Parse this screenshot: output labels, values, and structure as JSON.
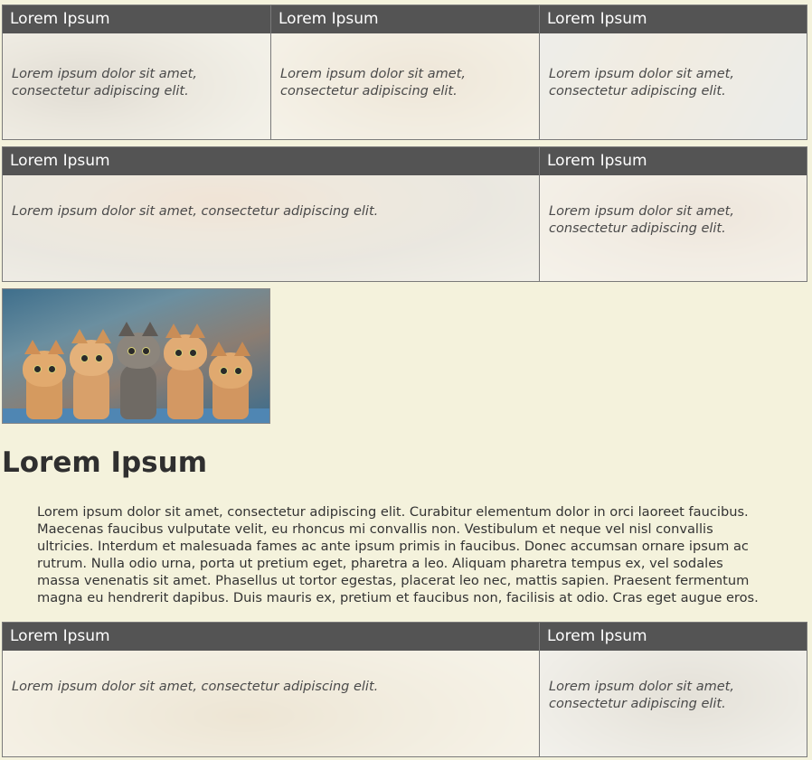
{
  "cards": [
    {
      "title": "Lorem Ipsum",
      "text": "Lorem ipsum dolor sit amet, consectetur adipiscing elit."
    },
    {
      "title": "Lorem Ipsum",
      "text": "Lorem ipsum dolor sit amet, consectetur adipiscing elit."
    },
    {
      "title": "Lorem Ipsum",
      "text": "Lorem ipsum dolor sit amet, consectetur adipiscing elit."
    },
    {
      "title": "Lorem Ipsum",
      "text": "Lorem ipsum dolor sit amet, consectetur adipiscing elit."
    },
    {
      "title": "Lorem Ipsum",
      "text": "Lorem ipsum dolor sit amet, consectetur adipiscing elit."
    }
  ],
  "article": {
    "heading": "Lorem Ipsum",
    "body": "Lorem ipsum dolor sit amet, consectetur adipiscing elit. Curabitur elementum dolor in orci laoreet faucibus. Maecenas faucibus vulputate velit, eu rhoncus mi convallis non. Vestibulum et neque vel nisl convallis ultricies. Interdum et malesuada fames ac ante ipsum primis in faucibus. Donec accumsan ornare ipsum ac rutrum. Nulla odio urna, porta ut pretium eget, pharetra a leo. Aliquam pharetra tempus ex, vel sodales massa venenatis sit amet. Phasellus ut tortor egestas, placerat leo nec, mattis sapien. Praesent fermentum magna eu hendrerit dapibus. Duis mauris ex, pretium et faucibus non, facilisis at odio. Cras eget augue eros."
  },
  "bottom_cards": [
    {
      "title": "Lorem Ipsum",
      "text": "Lorem ipsum dolor sit amet, consectetur adipiscing elit."
    },
    {
      "title": "Lorem Ipsum",
      "text": "Lorem ipsum dolor sit amet, consectetur adipiscing elit."
    }
  ],
  "colors": {
    "page_background": "#f4f2dc",
    "card_header": "#545454",
    "card_header_text": "#ffffff"
  }
}
